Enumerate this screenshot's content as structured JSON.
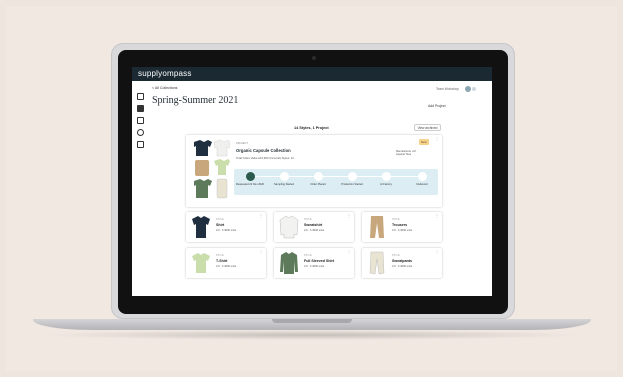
{
  "app": {
    "logo": "supplyompass",
    "breadcrumb": "< All Collections",
    "page_title": "Spring-Summer 2021",
    "team": "Team Workshop",
    "add_project": "Add Project",
    "summary": "14 Styles, 1 Project",
    "view_button": "View archived"
  },
  "collection": {
    "small_label": "PROJECT",
    "name": "Organic Capsule Collection",
    "meta": "Total Order Value   £10,960 (Incl+Intl)   Styles: 14",
    "badge": "New",
    "manufacturer": "Manufacturer +M Apparel Tees",
    "steps": [
      {
        "label": "Requested 22 Nov 2020",
        "done": true
      },
      {
        "label": "Sampling Started",
        "done": false
      },
      {
        "label": "Order Placed",
        "done": false
      },
      {
        "label": "Production Started",
        "done": false
      },
      {
        "label": "At Factory",
        "done": false
      },
      {
        "label": "Delivered",
        "done": false
      }
    ]
  },
  "products": [
    {
      "small": "STYLE",
      "name": "Shirt",
      "meta": "2-6 · 6   3000 units",
      "color": "#1f2f3f",
      "kind": "shirt"
    },
    {
      "small": "STYLE",
      "name": "Sweatshirt",
      "meta": "2-6 · 6   3000 units",
      "color": "#f2f2f0",
      "kind": "sweat"
    },
    {
      "small": "STYLE",
      "name": "Trousers",
      "meta": "2-6 · 6   3000 units",
      "color": "#c8a77d",
      "kind": "trousers"
    },
    {
      "small": "STYLE",
      "name": "T-Shirt",
      "meta": "2-6 · 6   3000 units",
      "color": "#c9deaa",
      "kind": "tee"
    },
    {
      "small": "STYLE",
      "name": "Full Sleeved Shirt",
      "meta": "2-6 · 6   3000 units",
      "color": "#5d7a5a",
      "kind": "longshirt"
    },
    {
      "small": "STYLE",
      "name": "Sweatpants",
      "meta": "2-6 · 6   3000 units",
      "color": "#e9e3d2",
      "kind": "pants"
    }
  ]
}
